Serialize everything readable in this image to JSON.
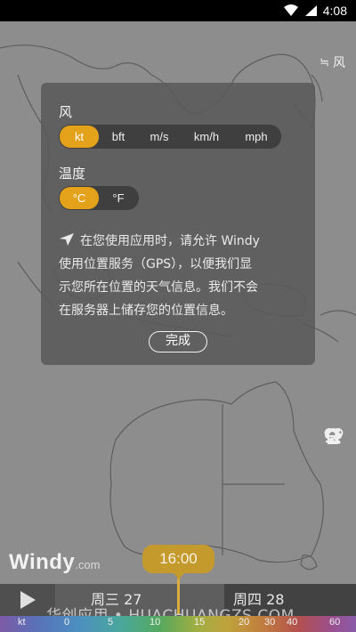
{
  "status_bar": {
    "time": "4:08"
  },
  "layer_toggle": {
    "label": "风"
  },
  "dialog": {
    "wind_label": "风",
    "wind_units": [
      "kt",
      "bft",
      "m/s",
      "km/h",
      "mph"
    ],
    "wind_selected": "kt",
    "temp_label": "温度",
    "temp_units": [
      "°C",
      "°F"
    ],
    "temp_selected": "°C",
    "info_lines": [
      "在您使用应用时，请允许 Windy",
      "使用位置服务（GPS），以便我们显",
      "示您所在位置的天气信息。我们不会",
      "在服务器上储存您的位置信息。"
    ],
    "done_label": "完成"
  },
  "logo": {
    "brand": "Windy",
    "suffix": ".com"
  },
  "timeline": {
    "current_time": "16:00",
    "day1": "周三 27",
    "day2": "周四 28"
  },
  "legend": {
    "unit": "kt",
    "ticks": [
      "0",
      "5",
      "10",
      "15",
      "20",
      "30",
      "40",
      "60"
    ]
  },
  "watermark": "华创应用 • HUACHUANGZS.COM",
  "icons": {
    "side_tools": [
      "home-icon",
      "weather-cloud-icon",
      "menu-icon",
      "search-icon",
      "heart-icon"
    ]
  },
  "colors": {
    "accent": "#e3a21a",
    "time_bubble": "#c49a2c"
  }
}
